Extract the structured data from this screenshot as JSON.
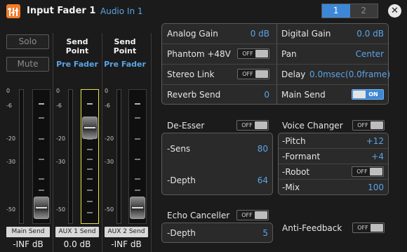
{
  "header": {
    "title": "Input Fader 1",
    "source": "Audio In 1",
    "tabs": [
      "1",
      "2"
    ],
    "active_tab": "1",
    "close_glyph": "✕"
  },
  "strips": [
    {
      "top_buttons": [
        "Solo",
        "Mute"
      ],
      "scale": [
        "0",
        "-6",
        "-20",
        "-30",
        "-50"
      ],
      "fader_level_db": "-INF",
      "name": "Main Send",
      "value": "-INF dB"
    },
    {
      "send_point_label": "Send Point",
      "send_point_value": "Pre Fader",
      "scale": [
        "0",
        "-6",
        "-20",
        "-30",
        "-50"
      ],
      "selected": true,
      "name": "AUX 1 Send",
      "value": "0.0 dB"
    },
    {
      "send_point_label": "Send Point",
      "send_point_value": "Pre Fader",
      "scale": [
        "0",
        "-6",
        "-20",
        "-30",
        "-50"
      ],
      "name": "AUX 2 Send",
      "value": "-INF dB"
    }
  ],
  "params": {
    "analog_gain": {
      "label": "Analog Gain",
      "value": "0 dB"
    },
    "digital_gain": {
      "label": "Digital Gain",
      "value": "0.0 dB"
    },
    "phantom": {
      "label": "Phantom +48V",
      "state": "OFF"
    },
    "pan": {
      "label": "Pan",
      "value": "Center"
    },
    "stereo_link": {
      "label": "Stereo Link",
      "state": "OFF"
    },
    "delay": {
      "label": "Delay",
      "value": "0.0msec(0.0frame)"
    },
    "reverb_send": {
      "label": "Reverb Send",
      "value": "0"
    },
    "main_send": {
      "label": "Main Send",
      "state": "ON"
    }
  },
  "de_esser": {
    "title": "De-Esser",
    "state": "OFF",
    "sens": {
      "label": "-Sens",
      "value": "80"
    },
    "depth": {
      "label": "-Depth",
      "value": "64"
    }
  },
  "voice_changer": {
    "title": "Voice Changer",
    "state": "OFF",
    "pitch": {
      "label": "-Pitch",
      "value": "+12"
    },
    "formant": {
      "label": "-Formant",
      "value": "+4"
    },
    "robot": {
      "label": "-Robot",
      "state": "OFF"
    },
    "mix": {
      "label": "-Mix",
      "value": "100"
    }
  },
  "echo_canceller": {
    "title": "Echo Canceller",
    "state": "OFF",
    "depth": {
      "label": "-Depth",
      "value": "5"
    }
  },
  "anti_feedback": {
    "title": "Anti-Feedback",
    "state": "OFF"
  },
  "colors": {
    "accent_blue": "#3d88d6",
    "value_blue": "#5ba4e6",
    "icon_orange": "#f07d2a",
    "selected_yellow": "#e8e24a"
  }
}
